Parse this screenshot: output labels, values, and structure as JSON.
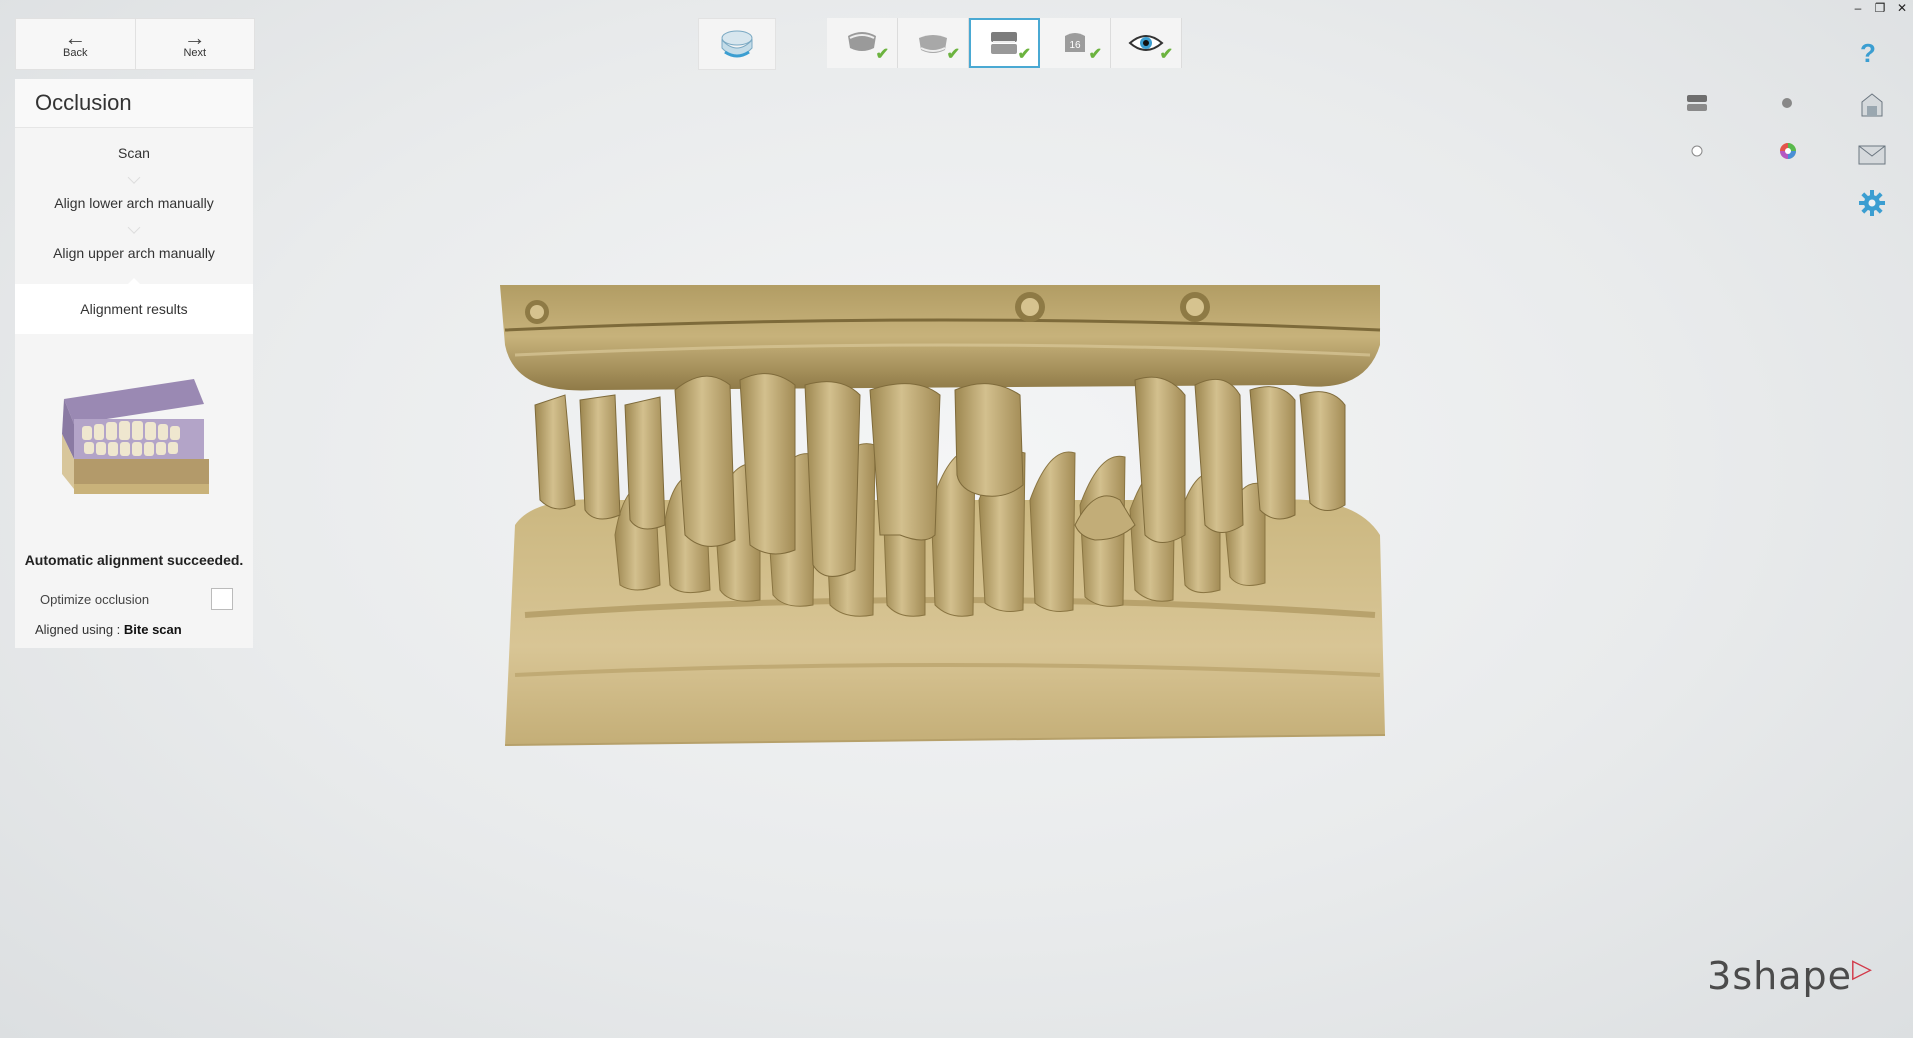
{
  "window": {
    "minimize": "–",
    "restore": "❐",
    "close": "✕"
  },
  "nav": {
    "back_label": "Back",
    "next_label": "Next"
  },
  "panel": {
    "title": "Occlusion",
    "steps": [
      {
        "label": "Scan"
      },
      {
        "label": "Align lower arch manually"
      },
      {
        "label": "Align upper arch manually"
      },
      {
        "label": "Alignment results"
      }
    ],
    "status": "Automatic alignment succeeded.",
    "optimize_label": "Optimize occlusion",
    "aligned_prefix": "Aligned using : ",
    "aligned_value": "Bite scan"
  },
  "toolbar": {
    "wizard_steps": [
      {
        "icon": "upper-scan-icon",
        "done": true
      },
      {
        "icon": "lower-scan-icon",
        "done": true
      },
      {
        "icon": "occlusion-icon",
        "done": true,
        "current": true
      },
      {
        "icon": "die-icon",
        "badge": "16",
        "done": true
      },
      {
        "icon": "eye-icon",
        "done": true
      }
    ]
  },
  "right_tools": {
    "help": "?"
  },
  "colors": {
    "accent": "#4aa9d3",
    "check": "#6cb33f",
    "model": "#c9b27a",
    "brand": "#d23a4a"
  },
  "brand": {
    "name": "3shape"
  }
}
